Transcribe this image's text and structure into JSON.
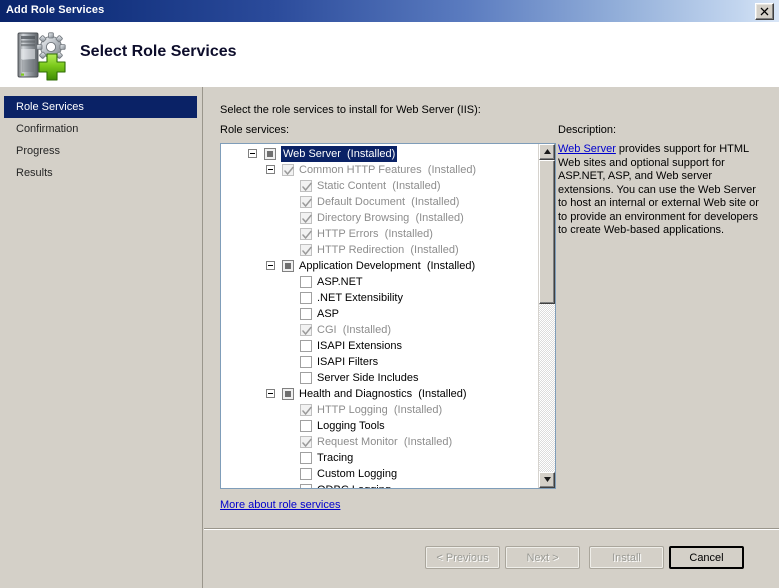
{
  "window": {
    "title": "Add Role Services",
    "close_icon": "close-x-icon"
  },
  "header": {
    "title": "Select Role Services",
    "icon": "server-role-add-icon"
  },
  "sidebar": {
    "items": [
      {
        "label": "Role Services",
        "selected": true
      },
      {
        "label": "Confirmation",
        "selected": false
      },
      {
        "label": "Progress",
        "selected": false
      },
      {
        "label": "Results",
        "selected": false
      }
    ]
  },
  "main": {
    "intro": "Select the role services to install for Web Server (IIS):",
    "roles_label": "Role services:",
    "description_label": "Description:",
    "more_link": "More about role services",
    "tree": [
      {
        "label": "Web Server",
        "suffix": "(Installed)",
        "level": 0,
        "expander": "minus",
        "check": "partial",
        "state": "selected"
      },
      {
        "label": "Common HTTP Features",
        "suffix": "(Installed)",
        "level": 1,
        "expander": "minus",
        "check": "checked-disabled",
        "state": "dim"
      },
      {
        "label": "Static Content",
        "suffix": "(Installed)",
        "level": 2,
        "expander": "none",
        "check": "checked-disabled",
        "state": "dim"
      },
      {
        "label": "Default Document",
        "suffix": "(Installed)",
        "level": 2,
        "expander": "none",
        "check": "checked-disabled",
        "state": "dim"
      },
      {
        "label": "Directory Browsing",
        "suffix": "(Installed)",
        "level": 2,
        "expander": "none",
        "check": "checked-disabled",
        "state": "dim"
      },
      {
        "label": "HTTP Errors",
        "suffix": "(Installed)",
        "level": 2,
        "expander": "none",
        "check": "checked-disabled",
        "state": "dim"
      },
      {
        "label": "HTTP Redirection",
        "suffix": "(Installed)",
        "level": 2,
        "expander": "none",
        "check": "checked-disabled",
        "state": "dim"
      },
      {
        "label": "Application Development",
        "suffix": "(Installed)",
        "level": 1,
        "expander": "minus",
        "check": "partial",
        "state": "normal"
      },
      {
        "label": "ASP.NET",
        "suffix": "",
        "level": 2,
        "expander": "none",
        "check": "unchecked",
        "state": "normal"
      },
      {
        "label": ".NET Extensibility",
        "suffix": "",
        "level": 2,
        "expander": "none",
        "check": "unchecked",
        "state": "normal"
      },
      {
        "label": "ASP",
        "suffix": "",
        "level": 2,
        "expander": "none",
        "check": "unchecked",
        "state": "normal"
      },
      {
        "label": "CGI",
        "suffix": "(Installed)",
        "level": 2,
        "expander": "none",
        "check": "checked-disabled",
        "state": "dim"
      },
      {
        "label": "ISAPI Extensions",
        "suffix": "",
        "level": 2,
        "expander": "none",
        "check": "unchecked",
        "state": "normal"
      },
      {
        "label": "ISAPI Filters",
        "suffix": "",
        "level": 2,
        "expander": "none",
        "check": "unchecked",
        "state": "normal"
      },
      {
        "label": "Server Side Includes",
        "suffix": "",
        "level": 2,
        "expander": "none",
        "check": "unchecked",
        "state": "normal"
      },
      {
        "label": "Health and Diagnostics",
        "suffix": "(Installed)",
        "level": 1,
        "expander": "minus",
        "check": "partial",
        "state": "normal"
      },
      {
        "label": "HTTP Logging",
        "suffix": "(Installed)",
        "level": 2,
        "expander": "none",
        "check": "checked-disabled",
        "state": "dim"
      },
      {
        "label": "Logging Tools",
        "suffix": "",
        "level": 2,
        "expander": "none",
        "check": "unchecked",
        "state": "normal"
      },
      {
        "label": "Request Monitor",
        "suffix": "(Installed)",
        "level": 2,
        "expander": "none",
        "check": "checked-disabled",
        "state": "dim"
      },
      {
        "label": "Tracing",
        "suffix": "",
        "level": 2,
        "expander": "none",
        "check": "unchecked",
        "state": "normal"
      },
      {
        "label": "Custom Logging",
        "suffix": "",
        "level": 2,
        "expander": "none",
        "check": "unchecked",
        "state": "normal"
      },
      {
        "label": "ODBC Logging",
        "suffix": "",
        "level": 2,
        "expander": "none",
        "check": "unchecked",
        "state": "normal"
      }
    ],
    "description": {
      "link_text": "Web Server",
      "body": " provides support for HTML Web sites and optional support for ASP.NET, ASP, and Web server extensions. You can use the Web Server to host an internal or external Web site or to provide an environment for developers to create Web-based applications."
    },
    "scrollbar": {
      "up_icon": "scroll-up-arrow-icon",
      "down_icon": "scroll-down-arrow-icon",
      "thumb_position_percent": 0,
      "thumb_size_percent": 46
    }
  },
  "footer": {
    "buttons": [
      {
        "id": "previous",
        "label": "< Previous",
        "enabled": false,
        "default": false
      },
      {
        "id": "next",
        "label": "Next >",
        "enabled": false,
        "default": false
      },
      {
        "id": "install",
        "label": "Install",
        "enabled": false,
        "default": false
      },
      {
        "id": "cancel",
        "label": "Cancel",
        "enabled": true,
        "default": true
      }
    ]
  },
  "colors": {
    "titlebar_dark": "#0a246a",
    "titlebar_light": "#d9e6f7",
    "selection": "#0a2266",
    "dialog_face": "#d4d0c8",
    "link": "#0000cc",
    "disabled_text": "#8d8d8d"
  }
}
